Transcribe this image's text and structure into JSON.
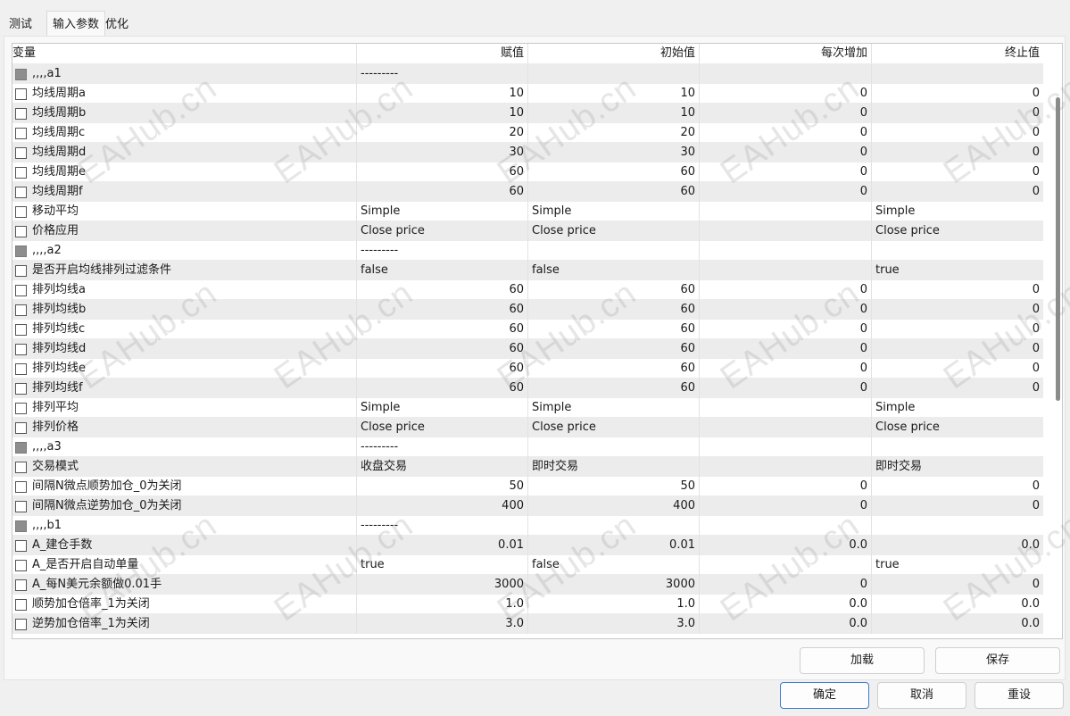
{
  "tabs": [
    "测试",
    "输入参数",
    "优化"
  ],
  "columns": [
    "变量",
    "赋值",
    "初始值",
    "每次增加",
    "终止值"
  ],
  "rows": [
    {
      "group": true,
      "name": ",,,,a1",
      "value": "---------",
      "start": "",
      "step": "",
      "stop": "",
      "num": false
    },
    {
      "group": false,
      "name": "均线周期a",
      "value": "10",
      "start": "10",
      "step": "0",
      "stop": "0",
      "num": true
    },
    {
      "group": false,
      "name": "均线周期b",
      "value": "10",
      "start": "10",
      "step": "0",
      "stop": "0",
      "num": true
    },
    {
      "group": false,
      "name": "均线周期c",
      "value": "20",
      "start": "20",
      "step": "0",
      "stop": "0",
      "num": true
    },
    {
      "group": false,
      "name": "均线周期d",
      "value": "30",
      "start": "30",
      "step": "0",
      "stop": "0",
      "num": true
    },
    {
      "group": false,
      "name": "均线周期e",
      "value": "60",
      "start": "60",
      "step": "0",
      "stop": "0",
      "num": true
    },
    {
      "group": false,
      "name": "均线周期f",
      "value": "60",
      "start": "60",
      "step": "0",
      "stop": "0",
      "num": true
    },
    {
      "group": false,
      "name": "移动平均",
      "value": "Simple",
      "start": "Simple",
      "step": "",
      "stop": "Simple",
      "num": false
    },
    {
      "group": false,
      "name": "价格应用",
      "value": "Close price",
      "start": "Close price",
      "step": "",
      "stop": "Close price",
      "num": false
    },
    {
      "group": true,
      "name": ",,,,a2",
      "value": "---------",
      "start": "",
      "step": "",
      "stop": "",
      "num": false
    },
    {
      "group": false,
      "name": "是否开启均线排列过滤条件",
      "value": "false",
      "start": "false",
      "step": "",
      "stop": "true",
      "num": false
    },
    {
      "group": false,
      "name": "排列均线a",
      "value": "60",
      "start": "60",
      "step": "0",
      "stop": "0",
      "num": true
    },
    {
      "group": false,
      "name": "排列均线b",
      "value": "60",
      "start": "60",
      "step": "0",
      "stop": "0",
      "num": true
    },
    {
      "group": false,
      "name": "排列均线c",
      "value": "60",
      "start": "60",
      "step": "0",
      "stop": "0",
      "num": true
    },
    {
      "group": false,
      "name": "排列均线d",
      "value": "60",
      "start": "60",
      "step": "0",
      "stop": "0",
      "num": true
    },
    {
      "group": false,
      "name": "排列均线e",
      "value": "60",
      "start": "60",
      "step": "0",
      "stop": "0",
      "num": true
    },
    {
      "group": false,
      "name": "排列均线f",
      "value": "60",
      "start": "60",
      "step": "0",
      "stop": "0",
      "num": true
    },
    {
      "group": false,
      "name": "排列平均",
      "value": "Simple",
      "start": "Simple",
      "step": "",
      "stop": "Simple",
      "num": false
    },
    {
      "group": false,
      "name": "排列价格",
      "value": "Close price",
      "start": "Close price",
      "step": "",
      "stop": "Close price",
      "num": false
    },
    {
      "group": true,
      "name": ",,,,a3",
      "value": "---------",
      "start": "",
      "step": "",
      "stop": "",
      "num": false
    },
    {
      "group": false,
      "name": "交易模式",
      "value": "收盘交易",
      "start": "即时交易",
      "step": "",
      "stop": "即时交易",
      "num": false
    },
    {
      "group": false,
      "name": "间隔N微点顺势加仓_0为关闭",
      "value": "50",
      "start": "50",
      "step": "0",
      "stop": "0",
      "num": true
    },
    {
      "group": false,
      "name": "间隔N微点逆势加仓_0为关闭",
      "value": "400",
      "start": "400",
      "step": "0",
      "stop": "0",
      "num": true
    },
    {
      "group": true,
      "name": ",,,,b1",
      "value": "---------",
      "start": "",
      "step": "",
      "stop": "",
      "num": false
    },
    {
      "group": false,
      "name": "A_建仓手数",
      "value": "0.01",
      "start": "0.01",
      "step": "0.0",
      "stop": "0.0",
      "num": true
    },
    {
      "group": false,
      "name": "A_是否开启自动单量",
      "value": "true",
      "start": "false",
      "step": "",
      "stop": "true",
      "num": false
    },
    {
      "group": false,
      "name": "A_每N美元余额做0.01手",
      "value": "3000",
      "start": "3000",
      "step": "0",
      "stop": "0",
      "num": true
    },
    {
      "group": false,
      "name": "顺势加仓倍率_1为关闭",
      "value": "1.0",
      "start": "1.0",
      "step": "0.0",
      "stop": "0.0",
      "num": true
    },
    {
      "group": false,
      "name": "逆势加仓倍率_1为关闭",
      "value": "3.0",
      "start": "3.0",
      "step": "0.0",
      "stop": "0.0",
      "num": true
    }
  ],
  "watermark": "EAHub.cn",
  "buttons": {
    "load": "加载",
    "save": "保存",
    "ok": "确定",
    "cancel": "取消",
    "reset": "重设"
  }
}
